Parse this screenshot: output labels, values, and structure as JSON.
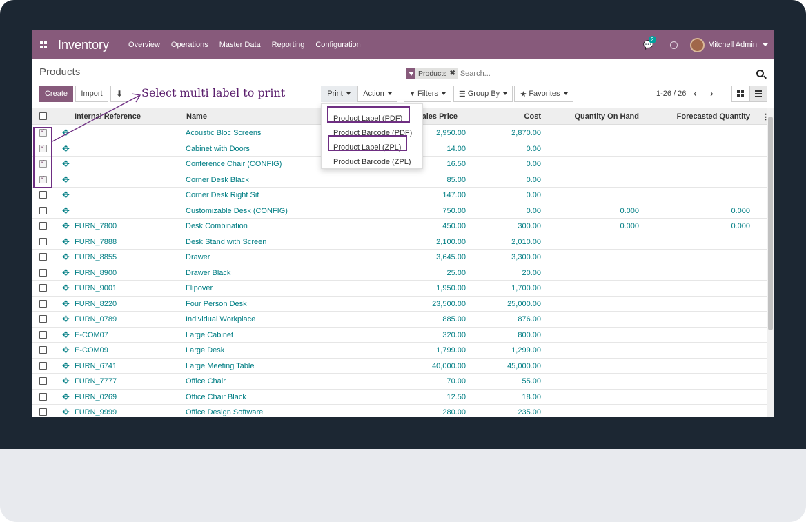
{
  "nav": {
    "brand": "Inventory",
    "menus": [
      "Overview",
      "Operations",
      "Master Data",
      "Reporting",
      "Configuration"
    ],
    "chat_count": "2",
    "user": "Mitchell Admin"
  },
  "page": {
    "title": "Products",
    "search_facet": "Products",
    "search_placeholder": "Search...",
    "buttons": {
      "create": "Create",
      "import": "Import",
      "print": "Print",
      "action": "Action",
      "filters": "Filters",
      "group_by": "Group By",
      "favorites": "Favorites"
    },
    "pager": "1-26 / 26"
  },
  "annotation": "Select multi label to print",
  "print_menu": [
    "Product Label (PDF)",
    "Product Barcode (PDF)",
    "Product Label (ZPL)",
    "Product Barcode (ZPL)"
  ],
  "columns": {
    "ref": "Internal Reference",
    "name": "Name",
    "sales_price": "Sales Price",
    "cost": "Cost",
    "qty_on_hand": "Quantity On Hand",
    "forecasted": "Forecasted Quantity"
  },
  "rows": [
    {
      "ref": "",
      "name": "Acoustic Bloc Screens",
      "price": "2,950.00",
      "cost": "2,870.00",
      "qoh": "",
      "fq": "",
      "checked": true
    },
    {
      "ref": "",
      "name": "Cabinet with Doors",
      "price": "14.00",
      "cost": "0.00",
      "qoh": "",
      "fq": "",
      "checked": true
    },
    {
      "ref": "",
      "name": "Conference Chair (CONFIG)",
      "price": "16.50",
      "cost": "0.00",
      "qoh": "",
      "fq": "",
      "checked": true
    },
    {
      "ref": "",
      "name": "Corner Desk Black",
      "price": "85.00",
      "cost": "0.00",
      "qoh": "",
      "fq": "",
      "checked": true
    },
    {
      "ref": "",
      "name": "Corner Desk Right Sit",
      "price": "147.00",
      "cost": "0.00",
      "qoh": "",
      "fq": "",
      "checked": false
    },
    {
      "ref": "",
      "name": "Customizable Desk (CONFIG)",
      "price": "750.00",
      "cost": "0.00",
      "qoh": "0.000",
      "fq": "0.000",
      "checked": false
    },
    {
      "ref": "FURN_7800",
      "name": "Desk Combination",
      "price": "450.00",
      "cost": "300.00",
      "qoh": "0.000",
      "fq": "0.000",
      "checked": false
    },
    {
      "ref": "FURN_7888",
      "name": "Desk Stand with Screen",
      "price": "2,100.00",
      "cost": "2,010.00",
      "qoh": "",
      "fq": "",
      "checked": false
    },
    {
      "ref": "FURN_8855",
      "name": "Drawer",
      "price": "3,645.00",
      "cost": "3,300.00",
      "qoh": "",
      "fq": "",
      "checked": false
    },
    {
      "ref": "FURN_8900",
      "name": "Drawer Black",
      "price": "25.00",
      "cost": "20.00",
      "qoh": "",
      "fq": "",
      "checked": false
    },
    {
      "ref": "FURN_9001",
      "name": "Flipover",
      "price": "1,950.00",
      "cost": "1,700.00",
      "qoh": "",
      "fq": "",
      "checked": false
    },
    {
      "ref": "FURN_8220",
      "name": "Four Person Desk",
      "price": "23,500.00",
      "cost": "25,000.00",
      "qoh": "",
      "fq": "",
      "checked": false
    },
    {
      "ref": "FURN_0789",
      "name": "Individual Workplace",
      "price": "885.00",
      "cost": "876.00",
      "qoh": "",
      "fq": "",
      "checked": false
    },
    {
      "ref": "E-COM07",
      "name": "Large Cabinet",
      "price": "320.00",
      "cost": "800.00",
      "qoh": "",
      "fq": "",
      "checked": false
    },
    {
      "ref": "E-COM09",
      "name": "Large Desk",
      "price": "1,799.00",
      "cost": "1,299.00",
      "qoh": "",
      "fq": "",
      "checked": false
    },
    {
      "ref": "FURN_6741",
      "name": "Large Meeting Table",
      "price": "40,000.00",
      "cost": "45,000.00",
      "qoh": "",
      "fq": "",
      "checked": false
    },
    {
      "ref": "FURN_7777",
      "name": "Office Chair",
      "price": "70.00",
      "cost": "55.00",
      "qoh": "",
      "fq": "",
      "checked": false
    },
    {
      "ref": "FURN_0269",
      "name": "Office Chair Black",
      "price": "12.50",
      "cost": "18.00",
      "qoh": "",
      "fq": "",
      "checked": false
    },
    {
      "ref": "FURN_9999",
      "name": "Office Design Software",
      "price": "280.00",
      "cost": "235.00",
      "qoh": "",
      "fq": "",
      "checked": false
    }
  ],
  "colors": {
    "brand": "#875a7b",
    "link": "#017e84",
    "highlight": "#6e2e82"
  }
}
